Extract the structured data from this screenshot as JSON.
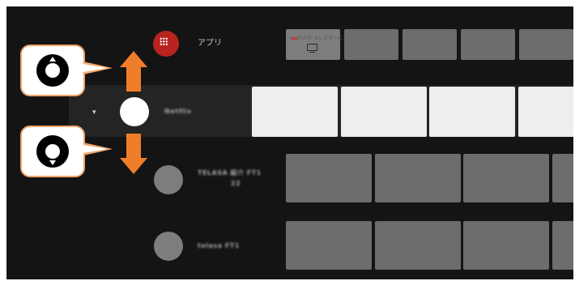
{
  "rows": {
    "apps": {
      "label": "アプリ",
      "icon": "grid-icon",
      "accent": "#b8231f"
    },
    "focused": {
      "label": "Netflix",
      "expand": "▾"
    },
    "row3": {
      "label_line1": "TELASA 紹介 FT1",
      "label_line2": "22"
    },
    "row4": {
      "label": "telasa FT1"
    }
  },
  "first_tile": {
    "brand": "au",
    "text": "ひかり",
    "sub": "テレビサービス",
    "icon": "tv-icon"
  },
  "callouts": {
    "up": {
      "icon": "remote-dpad-up-icon",
      "arrow": "up-arrow-icon",
      "color": "#f07d2a"
    },
    "down": {
      "icon": "remote-dpad-down-icon",
      "arrow": "down-arrow-icon",
      "color": "#f07d2a"
    }
  }
}
